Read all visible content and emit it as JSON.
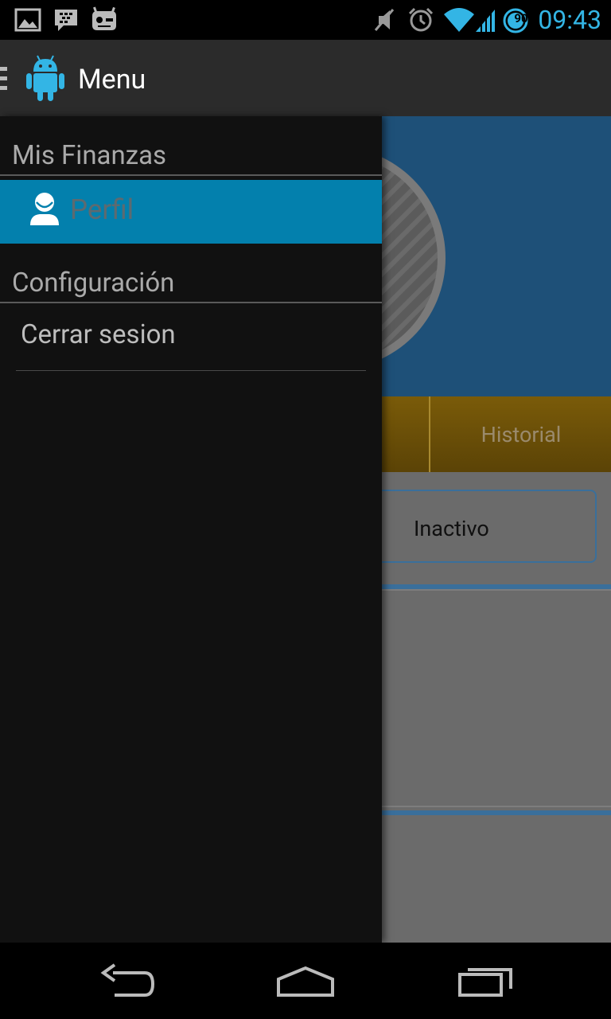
{
  "status_bar": {
    "time": "09:43",
    "battery_level": "90",
    "icons": [
      "gallery-notification-icon",
      "bbm-notification-icon",
      "cyanogenmod-icon",
      "muted-icon",
      "alarm-icon",
      "wifi-icon",
      "signal-icon",
      "battery-icon"
    ]
  },
  "action_bar": {
    "title": "Menu",
    "app_icon": "android-icon",
    "drawer_indicator": "drawer-indicator-icon"
  },
  "drawer": {
    "sections": [
      {
        "title": "Mis Finanzas",
        "items": [
          {
            "label": "Perfil",
            "icon": "profile-icon",
            "selected": true
          }
        ]
      },
      {
        "title": "Configuración",
        "items": [
          {
            "label": "Cerrar sesion",
            "selected": false
          }
        ]
      }
    ]
  },
  "background": {
    "tab_label": "Historial",
    "status_button": "Inactivo"
  },
  "nav_bar": {
    "buttons": [
      "back-icon",
      "home-icon",
      "recents-icon"
    ]
  },
  "colors": {
    "accent": "#33b5e5",
    "selected_item": "#0380ad",
    "drawer_bg": "#111111"
  }
}
